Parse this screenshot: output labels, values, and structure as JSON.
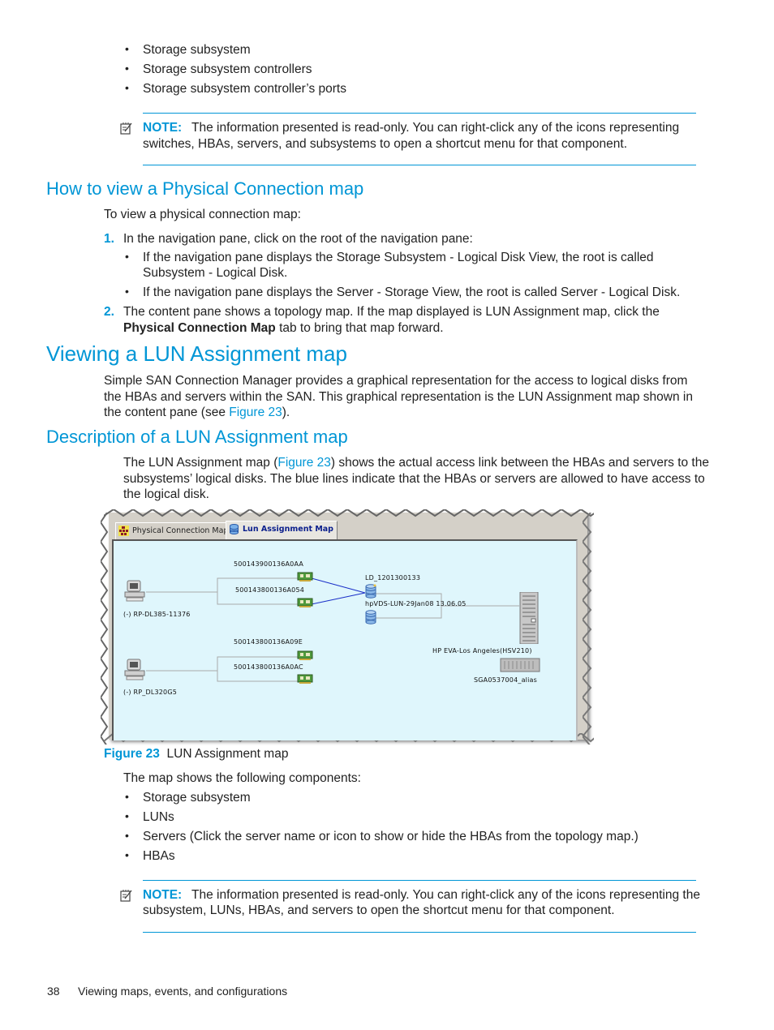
{
  "top_bullets": [
    "Storage subsystem",
    "Storage subsystem controllers",
    "Storage subsystem controller’s ports"
  ],
  "note1": {
    "label": "NOTE:",
    "line1": "The information presented is read-only. You can right-click any of the icons representing",
    "line2": "switches, HBAs, servers, and subsystems to open a shortcut menu for that component."
  },
  "section_physical": {
    "heading": "How to view a Physical Connection map",
    "intro": "To view a physical connection map:",
    "step1": {
      "number": "1.",
      "text": "In the navigation pane, click on the root of the navigation pane:",
      "sub1_line1": "If the navigation pane displays the Storage Subsystem - Logical Disk View, the root is called",
      "sub1_line2": "Subsystem - Logical Disk.",
      "sub2": "If the navigation pane displays the Server - Storage View, the root is called Server - Logical Disk."
    },
    "step2": {
      "number": "2.",
      "line1": "The content pane shows a topology map. If the map displayed is LUN Assignment map, click the",
      "bold": "Physical Connection Map",
      "line2_rest": " tab to bring that map forward."
    }
  },
  "section_viewing": {
    "heading": "Viewing a LUN Assignment map",
    "line1": "Simple SAN Connection Manager provides a graphical representation for the access to logical disks from",
    "line2": "the HBAs and servers within the SAN. This graphical representation is the LUN Assignment map shown in",
    "line3_pre": "the content pane (see ",
    "line3_link": "Figure 23",
    "line3_post": ")."
  },
  "section_description": {
    "heading": "Description of a LUN Assignment map",
    "line1_pre": "The LUN Assignment map (",
    "line1_link": "Figure 23",
    "line1_post": ") shows the actual access link between the HBAs and servers to the",
    "line2": "subsystems’ logical disks. The blue lines indicate that the HBAs or servers are allowed to have access to",
    "line3": "the logical disk."
  },
  "figure": {
    "tabs": [
      {
        "label": "Physical Connection Map",
        "active": false
      },
      {
        "label": "Lun Assignment Map",
        "active": true
      }
    ],
    "servers": [
      {
        "name": "(-) RP-DL385-11376",
        "hbas": [
          "500143900136A0AA",
          "500143800136A054"
        ]
      },
      {
        "name": "(-) RP_DL320G5",
        "hbas": [
          "500143800136A09E",
          "500143800136A0AC"
        ]
      }
    ],
    "luns": [
      "LD_1201300133",
      "hpVDS-LUN-29Jan08 13.06.05"
    ],
    "subsystem": {
      "name": "HP EVA-Los Angeles(HSV210)",
      "alias": "SGA0537004_alias"
    },
    "access_line_color": "#1a2fc8",
    "caption_label": "Figure 23",
    "caption_text": "LUN Assignment map"
  },
  "components": {
    "intro": "The map shows the following components:",
    "items": [
      "Storage subsystem",
      "LUNs",
      "Servers (Click the server name or icon to show or hide the HBAs from the topology map.)",
      "HBAs"
    ]
  },
  "note2": {
    "label": "NOTE:",
    "line1": "The information presented is read-only. You can right-click any of the icons representing the",
    "line2": "subsystem, LUNs, HBAs, and servers to open the shortcut menu for that component."
  },
  "footer": {
    "page_number": "38",
    "chapter": "Viewing maps, events, and configurations"
  },
  "colors": {
    "accent": "#0096d6",
    "canvas_bg": "#dff6fc"
  }
}
